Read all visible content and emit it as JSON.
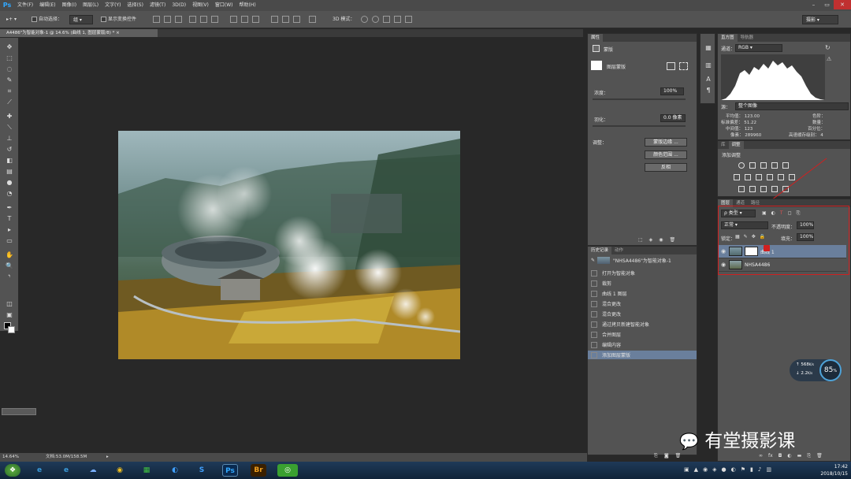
{
  "app": {
    "logo": "Ps"
  },
  "menu": [
    "文件(F)",
    "编辑(E)",
    "图像(I)",
    "图层(L)",
    "文字(Y)",
    "选择(S)",
    "滤镜(T)",
    "3D(D)",
    "视图(V)",
    "窗口(W)",
    "帮助(H)"
  ],
  "options": {
    "auto_select_label": "自动选择：",
    "auto_select_value": "组",
    "show_transform_label": "显示变换控件",
    "mode_3d_label": "3D 模式：",
    "workspace": "摄影"
  },
  "document": {
    "tab_title": "A4486\"为智能对象-1 @ 14.6% (曲线 1, 图层蒙版/8) *",
    "zoom": "14.64%",
    "doc_size": "文档:53.0M/158.5M"
  },
  "properties": {
    "tab": "属性",
    "title": "蒙版",
    "mask_type": "图层蒙版",
    "density_label": "浓度：",
    "density_value": "100%",
    "feather_label": "羽化：",
    "feather_value": "0.0 像素",
    "adjust_label": "调整：",
    "btn_mask_edge": "蒙版边缘 ...",
    "btn_color_range": "颜色范围 ...",
    "btn_invert": "反相"
  },
  "history": {
    "tabs": [
      "历史记录",
      "动作"
    ],
    "snapshot": "\"NHSA4486\"为智能对象-1",
    "items": [
      "打开为智能对象",
      "裁剪",
      "曲线 1 图层",
      "混合更改",
      "混合更改",
      "通过拷贝新建智能对象",
      "合并图层",
      "编辑内容",
      "添加图层蒙版"
    ]
  },
  "histogram": {
    "tabs": [
      "直方图",
      "导航器"
    ],
    "channel_label": "通道：",
    "channel_value": "RGB",
    "source_label": "源：",
    "source_value": "整个图像",
    "stats": [
      {
        "label": "平均值：",
        "value": "123.00"
      },
      {
        "label": "标准偏差：",
        "value": "51.22"
      },
      {
        "label": "中间值：",
        "value": "123"
      },
      {
        "label": "像素：",
        "value": "289960"
      }
    ],
    "stats_right": [
      {
        "label": "色阶："
      },
      {
        "label": "数量："
      },
      {
        "label": "百分位："
      },
      {
        "label": "高速缓存级别：",
        "value": "4"
      }
    ]
  },
  "adjustments": {
    "tabs": [
      "库",
      "调整"
    ],
    "title": "添加调整"
  },
  "layers": {
    "tabs": [
      "图层",
      "通道",
      "路径"
    ],
    "filter_value": "ρ 类型",
    "blend_mode": "正常",
    "opacity_label": "不透明度：",
    "opacity_value": "100%",
    "lock_label": "锁定：",
    "fill_label": "填充：",
    "fill_value": "100%",
    "items": [
      {
        "name": "曲线 1",
        "selected": true
      },
      {
        "name": "NHSA4486",
        "selected": false
      }
    ]
  },
  "netwidget": {
    "up": "568",
    "up_unit": "K/s",
    "down": "2.2",
    "down_unit": "K/s",
    "percent": "85",
    "percent_unit": "%"
  },
  "watermark": "有堂摄影课",
  "taskbar": {
    "time": "17:42",
    "date": "2018/10/15"
  },
  "colors": {
    "accent": "#31a8ff",
    "selection": "#6a7f9c",
    "annotation": "#d02020"
  }
}
